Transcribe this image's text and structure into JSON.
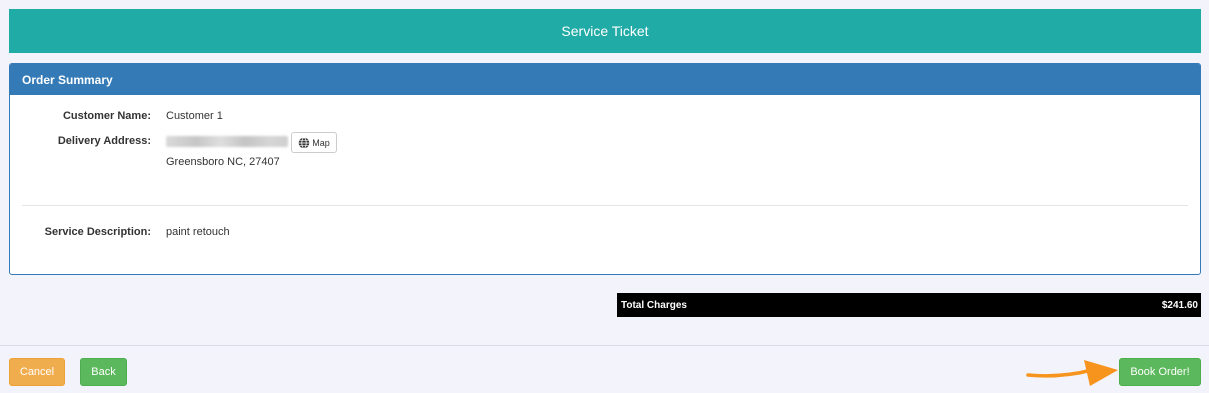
{
  "header": {
    "title": "Service Ticket"
  },
  "order_summary": {
    "title": "Order Summary",
    "customer_name_label": "Customer Name:",
    "customer_name": "Customer 1",
    "delivery_address_label": "Delivery Address:",
    "address_line2": "Greensboro NC, 27407",
    "map_button_label": "Map",
    "service_description_label": "Service Description:",
    "service_description": "paint retouch"
  },
  "totals": {
    "label": "Total Charges",
    "amount": "$241.60"
  },
  "footer": {
    "cancel_label": "Cancel",
    "back_label": "Back",
    "book_label": "Book Order!"
  },
  "colors": {
    "header_bg": "#20aba6",
    "panel_heading_bg": "#337ab7",
    "cancel": "#f0ad4e",
    "success": "#5cb85c",
    "arrow": "#f7941d"
  },
  "icons": {
    "map": "globe-icon",
    "annotation": "arrow-right-icon"
  }
}
